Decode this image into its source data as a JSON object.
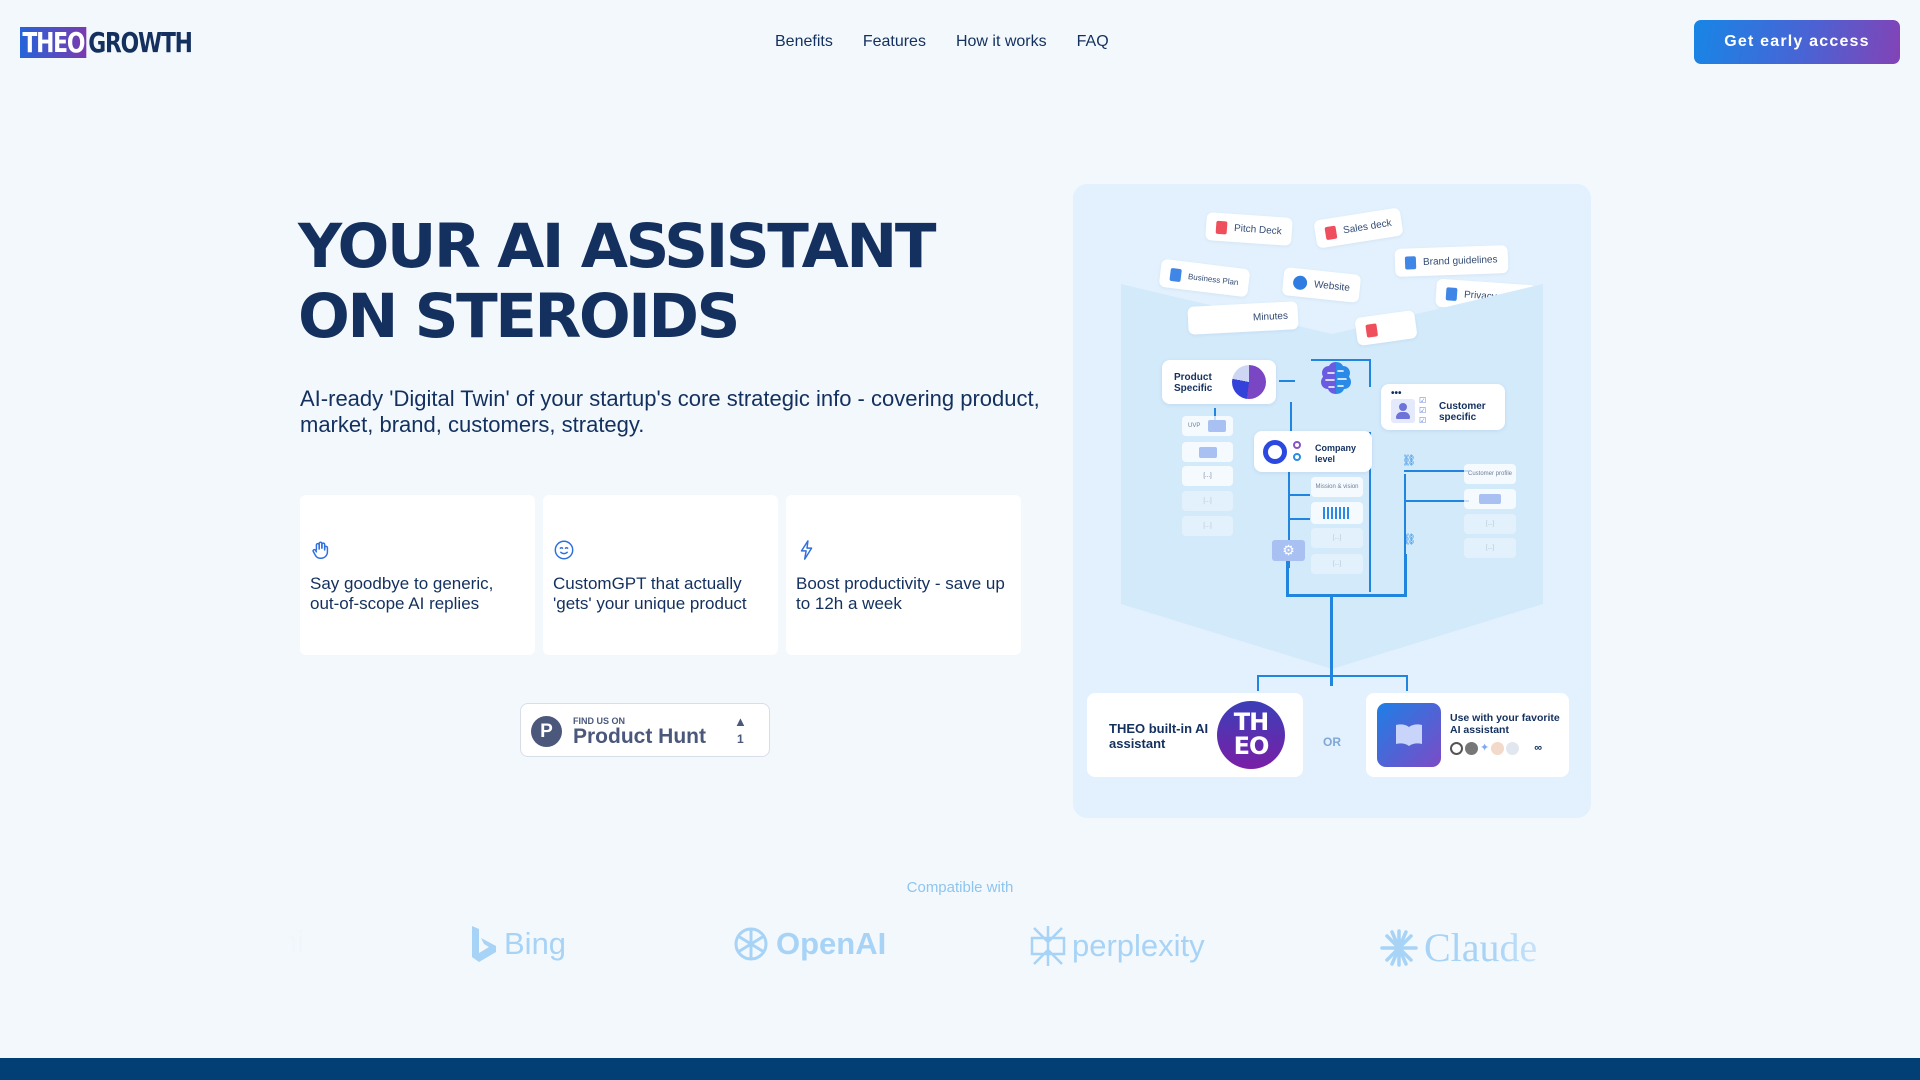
{
  "header": {
    "logo": {
      "part1": "THEO",
      "part2": "GROWTH"
    },
    "nav": [
      "Benefits",
      "Features",
      "How it works",
      "FAQ"
    ],
    "cta_label": "Get early access"
  },
  "hero": {
    "title_line1": "YOUR AI ASSISTANT",
    "title_line2": "ON STEROIDS",
    "subtitle": "AI-ready 'Digital Twin' of your startup's core strategic info - covering product, market, brand, customers, strategy.",
    "benefits": [
      {
        "icon": "waving-hand-icon",
        "text": "Say goodbye to generic, out-of-scope AI replies"
      },
      {
        "icon": "smiley-face-icon",
        "text": "CustomGPT that actually 'gets' your unique product"
      },
      {
        "icon": "lightning-bolt-icon",
        "text": "Boost productivity - save up to 12h a week"
      }
    ],
    "product_hunt": {
      "small": "FIND US ON",
      "big": "Product Hunt",
      "logo_letter": "P",
      "upvotes": "1"
    }
  },
  "diagram": {
    "documents": [
      "Pitch Deck",
      "Sales deck",
      "Business Plan",
      "Website",
      "Brand guidelines",
      "Privacy",
      "Minutes"
    ],
    "nodes": {
      "product": "Product Specific",
      "company": "Company level",
      "customer": "Customer specific"
    },
    "sub_items": {
      "uvp": "UVP",
      "mission": "Mission & vision",
      "customer_profile": "Customer profile",
      "placeholder": "[...]"
    },
    "theo_card": {
      "text": "THEO built-in AI assistant",
      "badge_top": "TH",
      "badge_bottom": "EO"
    },
    "or_label": "OR",
    "external_card": {
      "text": "Use with your favorite AI assistant",
      "more_symbol": "∞"
    }
  },
  "compatible": {
    "label": "Compatible with",
    "brands": [
      "Bing",
      "OpenAI",
      "perplexity",
      "Claude"
    ],
    "partial_brand_fragment": "ni"
  },
  "colors": {
    "navy": "#13305e",
    "accent_blue": "#1786e6",
    "accent_purple": "#8343b6",
    "footer": "#023f74"
  }
}
